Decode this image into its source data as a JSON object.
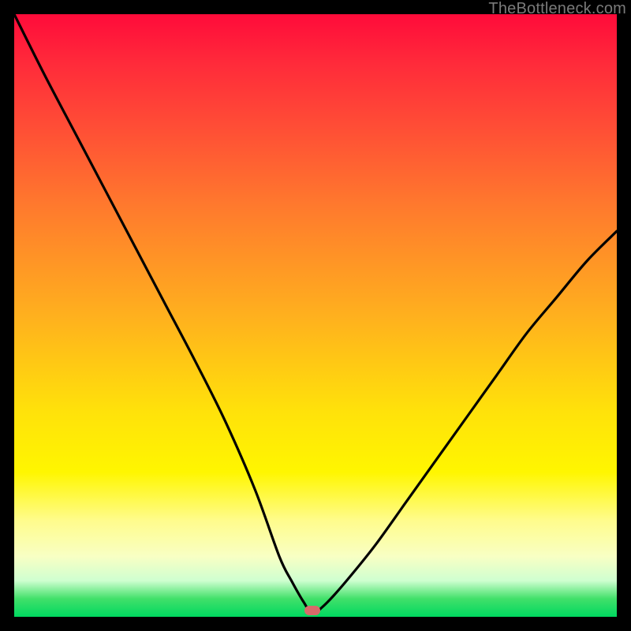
{
  "watermark": "TheBottleneck.com",
  "marker": {
    "x_pct": 49.5,
    "y_pct": 99.0
  },
  "chart_data": {
    "type": "line",
    "title": "",
    "xlabel": "",
    "ylabel": "",
    "xlim": [
      0,
      100
    ],
    "ylim": [
      0,
      100
    ],
    "grid": false,
    "legend": false,
    "series": [
      {
        "name": "bottleneck-curve",
        "x": [
          0,
          5,
          10,
          15,
          20,
          25,
          30,
          35,
          40,
          44,
          46,
          48,
          49.5,
          51,
          53,
          56,
          60,
          65,
          70,
          75,
          80,
          85,
          90,
          95,
          100
        ],
        "y": [
          100,
          90,
          80.5,
          71,
          61.5,
          52,
          42.5,
          32.5,
          21,
          10,
          6,
          2.5,
          0.5,
          1.5,
          3.5,
          7,
          12,
          19,
          26,
          33,
          40,
          47,
          53,
          59,
          64
        ]
      }
    ],
    "gradient_stops": [
      {
        "pct": 0,
        "color": "#ff0b3a"
      },
      {
        "pct": 8,
        "color": "#ff2a3a"
      },
      {
        "pct": 18,
        "color": "#ff4b36"
      },
      {
        "pct": 32,
        "color": "#ff7a2d"
      },
      {
        "pct": 50,
        "color": "#ffb01e"
      },
      {
        "pct": 66,
        "color": "#ffe20a"
      },
      {
        "pct": 76,
        "color": "#fff600"
      },
      {
        "pct": 84,
        "color": "#fffc8c"
      },
      {
        "pct": 90,
        "color": "#f8ffc4"
      },
      {
        "pct": 94,
        "color": "#cfffd0"
      },
      {
        "pct": 97,
        "color": "#41e06a"
      },
      {
        "pct": 100,
        "color": "#00d860"
      }
    ],
    "annotations": [
      {
        "type": "marker",
        "x": 49.5,
        "y": 0.5,
        "shape": "pill",
        "color": "#d86a6a"
      }
    ]
  }
}
